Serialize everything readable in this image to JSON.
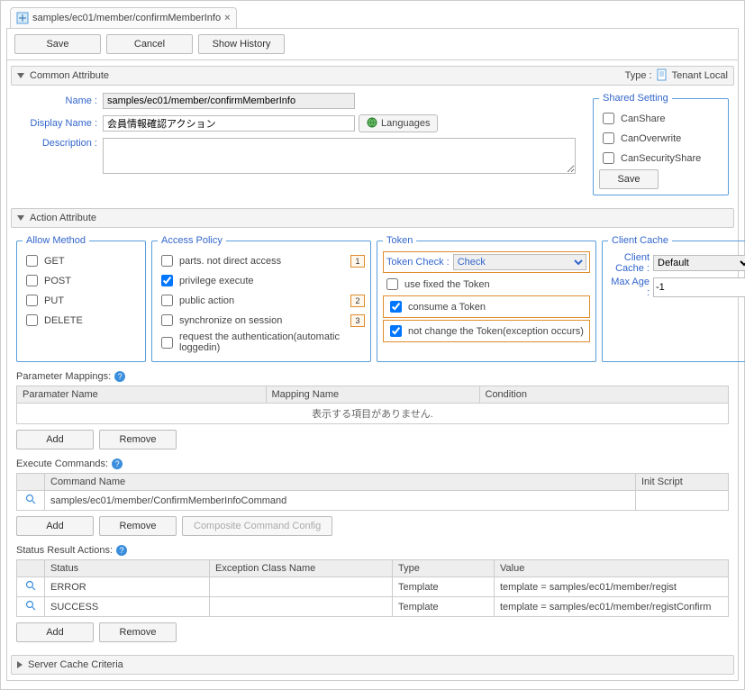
{
  "tab": {
    "label": "samples/ec01/member/confirmMemberInfo",
    "close": "×"
  },
  "toolbar": {
    "save": "Save",
    "cancel": "Cancel",
    "history": "Show History"
  },
  "sections": {
    "common": "Common Attribute",
    "action": "Action Attribute",
    "serverCache": "Server Cache Criteria"
  },
  "typeLabel": "Type :",
  "typeValue": "Tenant Local",
  "common": {
    "nameLabel": "Name :",
    "name": "samples/ec01/member/confirmMemberInfo",
    "displayLabel": "Display Name :",
    "display": "会員情報確認アクション",
    "langBtn": "Languages",
    "descLabel": "Description :",
    "desc": ""
  },
  "shared": {
    "legend": "Shared Setting",
    "canShare": "CanShare",
    "canOverwrite": "CanOverwrite",
    "canSecurity": "CanSecurityShare",
    "save": "Save"
  },
  "allowMethod": {
    "legend": "Allow Method",
    "get": "GET",
    "post": "POST",
    "put": "PUT",
    "delete": "DELETE"
  },
  "accessPolicy": {
    "legend": "Access Policy",
    "parts": "parts. not direct access",
    "priv": "privilege execute",
    "public": "public action",
    "sync": "synchronize on session",
    "auth": "request the authentication(automatic loggedin)"
  },
  "callouts": {
    "c1": "1",
    "c2": "2",
    "c3": "3"
  },
  "token": {
    "legend": "Token",
    "checkLabel": "Token Check :",
    "checkVal": "Check",
    "fixed": "use fixed the Token",
    "consume": "consume a Token",
    "notChange": "not change the Token(exception occurs)"
  },
  "clientCache": {
    "legend": "Client Cache",
    "cacheLabel": "Client Cache :",
    "cacheVal": "Default",
    "ageLabel": "Max Age :",
    "ageVal": "-1"
  },
  "paramMappings": {
    "title": "Parameter Mappings:",
    "cols": {
      "name": "Paramater Name",
      "mapping": "Mapping Name",
      "cond": "Condition"
    },
    "empty": "表示する項目がありません.",
    "add": "Add",
    "remove": "Remove"
  },
  "execCmds": {
    "title": "Execute Commands:",
    "cols": {
      "name": "Command Name",
      "init": "Init Script"
    },
    "rows": [
      {
        "name": "samples/ec01/member/ConfirmMemberInfoCommand"
      }
    ],
    "add": "Add",
    "remove": "Remove",
    "composite": "Composite Command Config"
  },
  "statusResults": {
    "title": "Status Result Actions:",
    "cols": {
      "status": "Status",
      "ex": "Exception Class Name",
      "type": "Type",
      "value": "Value"
    },
    "rows": [
      {
        "status": "ERROR",
        "ex": "",
        "type": "Template",
        "value": "template = samples/ec01/member/regist"
      },
      {
        "status": "SUCCESS",
        "ex": "",
        "type": "Template",
        "value": "template = samples/ec01/member/registConfirm"
      }
    ],
    "add": "Add",
    "remove": "Remove"
  }
}
